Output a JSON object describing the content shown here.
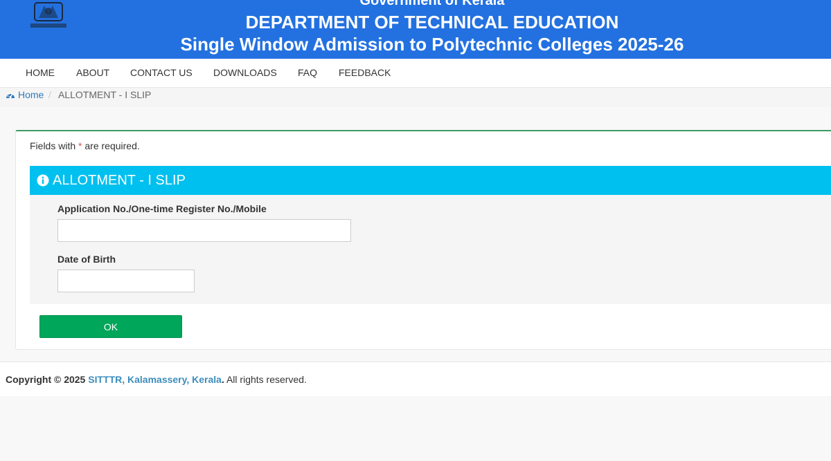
{
  "header": {
    "gov_text": "Government of Kerala",
    "dept_text": "DEPARTMENT OF TECHNICAL EDUCATION",
    "subtitle_text": "Single Window Admission to Polytechnic Colleges 2025-26",
    "emblem_icon": "kerala-emblem-icon",
    "bg_color": "#2371e0"
  },
  "nav": {
    "items": [
      {
        "label": "HOME"
      },
      {
        "label": "ABOUT"
      },
      {
        "label": "CONTACT US"
      },
      {
        "label": "DOWNLOADS"
      },
      {
        "label": "FAQ"
      },
      {
        "label": "FEEDBACK"
      }
    ]
  },
  "breadcrumb": {
    "home_label": "Home",
    "home_icon": "dashboard-icon",
    "separator": "/",
    "current": "ALLOTMENT - I SLIP"
  },
  "form": {
    "required_prefix": "Fields with",
    "required_star": "*",
    "required_suffix": "are required.",
    "panel_title": "ALLOTMENT - I SLIP",
    "panel_icon": "info-circle-icon",
    "panel_color": "#00c0ef",
    "fields": [
      {
        "label": "Application No./One-time Register No./Mobile",
        "value": ""
      },
      {
        "label": "Date of Birth",
        "value": ""
      }
    ],
    "ok_label": "OK",
    "ok_color": "#00a65a"
  },
  "footer": {
    "prefix": "Copyright © 2025",
    "link": "SITTTR, Kalamassery, Kerala",
    "dot": ".",
    "suffix": "All rights reserved."
  }
}
